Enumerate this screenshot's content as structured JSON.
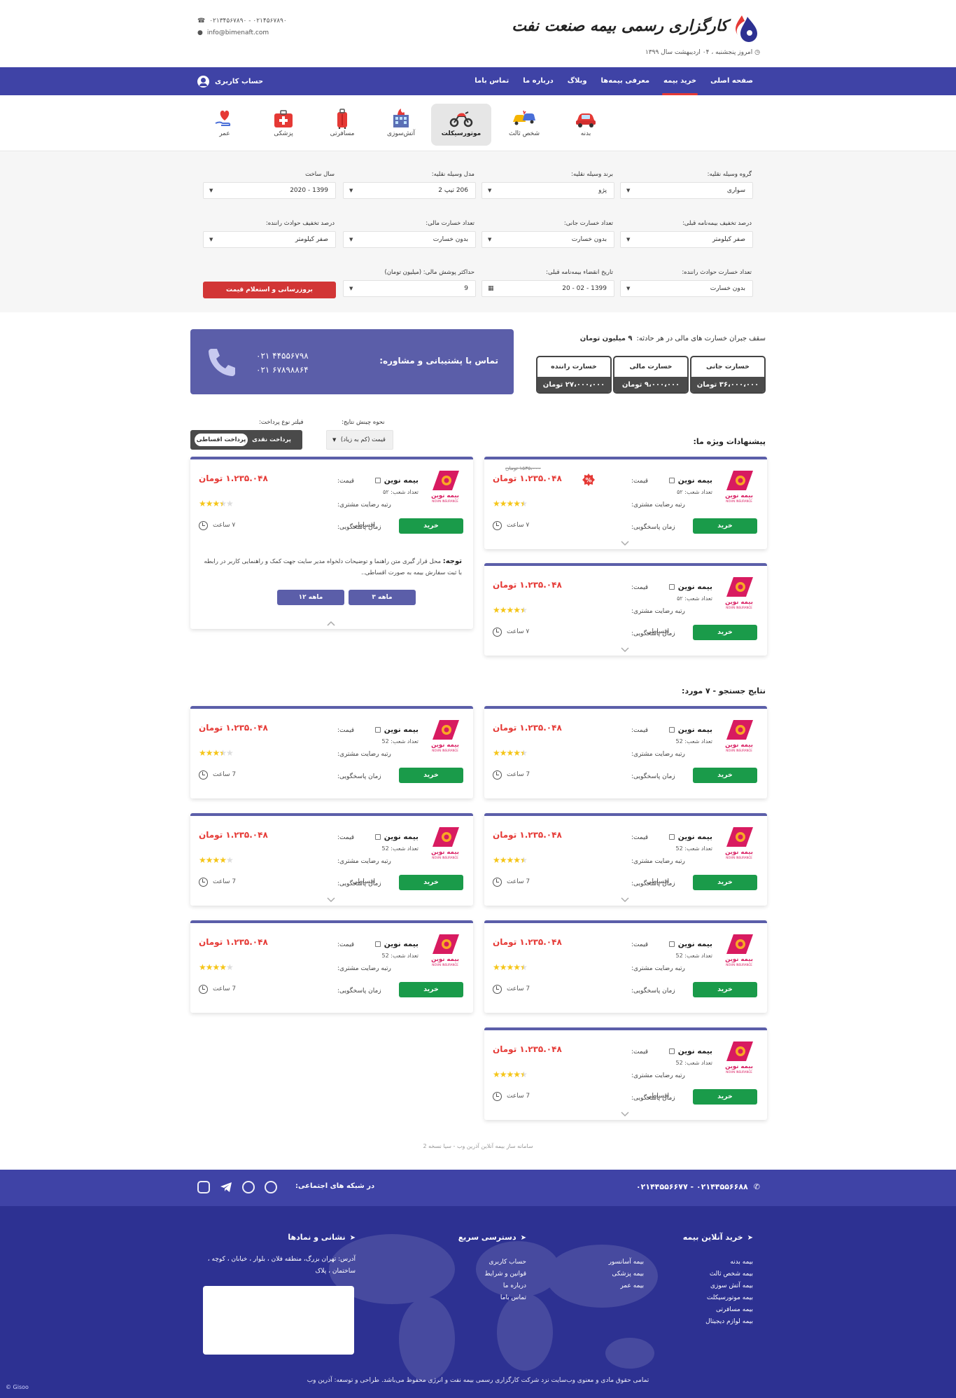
{
  "header": {
    "brand": "کارگزاری رسمی بیمه صنعت نفت",
    "date_text": "امروز پنجشنبه ، ۰۴ اردیبهشت سال ۱۳۹۹",
    "phone": "۰۲۱۳۴۵۶۷۸۹۰ - ۰۲۱۴۵۶۷۸۹۰",
    "email": "info@bimenaft.com"
  },
  "nav": {
    "items": [
      "صفحه اصلی",
      "خرید بیمه",
      "معرفی بیمه‌ها",
      "وبلاگ",
      "درباره ما",
      "تماس باما"
    ],
    "active_index": 1,
    "account_label": "حساب کاربری"
  },
  "categories": [
    {
      "label": "بدنه",
      "icon": "car-icon"
    },
    {
      "label": "شخص ثالث",
      "icon": "car-crash-icon"
    },
    {
      "label": "موتورسیکلت",
      "icon": "motorcycle-icon"
    },
    {
      "label": "آتش‌سوزی",
      "icon": "building-fire-icon"
    },
    {
      "label": "مسافرتی",
      "icon": "suitcase-icon"
    },
    {
      "label": "پزشکی",
      "icon": "medical-kit-icon"
    },
    {
      "label": "عمر",
      "icon": "heart-hand-icon"
    }
  ],
  "active_category": 2,
  "form": {
    "vehicle_group": {
      "label": "گروه وسیله نقلیه:",
      "value": "سواری"
    },
    "vehicle_brand": {
      "label": "برند وسیله نقلیه:",
      "value": "پژو"
    },
    "vehicle_model": {
      "label": "مدل وسیله نقلیه:",
      "value": "206 تیپ 2"
    },
    "build_year": {
      "label": "سال ساخت",
      "value": "1399 - 2020"
    },
    "prev_discount": {
      "label": "درصد تخفیف بیمه‌نامه قبلی:",
      "value": "صفر کیلومتر"
    },
    "life_damage": {
      "label": "تعداد خسارت جانی:",
      "value": "بدون خسارت"
    },
    "financial_damage": {
      "label": "تعداد خسارت مالی:",
      "value": "بدون خسارت"
    },
    "driver_discount": {
      "label": "درصد تخفیف حوادث راننده:",
      "value": "صفر کیلومتر"
    },
    "driver_damage": {
      "label": "تعداد خسارت حوادث راننده:",
      "value": "بدون خسارت"
    },
    "prev_expiry": {
      "label": "تاریخ انقضاء بیمه‌نامه قبلی:",
      "value": "1399 - 02 - 20"
    },
    "max_coverage": {
      "label": "حداکثر پوشش مالی: (میلیون تومان)",
      "value": "9"
    },
    "submit_label": "بروزرسانی و استعلام قیمت"
  },
  "coverage": {
    "title": "سقف جبران خسارت های مالی در هر حادثه:",
    "title_value": "۹ میلیون تومان",
    "items": [
      {
        "label": "خسارت جانی",
        "value": "۳۶،۰۰۰،۰۰۰ تومان"
      },
      {
        "label": "خسارت مالی",
        "value": "۹،۰۰۰،۰۰۰ تومان"
      },
      {
        "label": "خسارت راننده",
        "value": "۲۷،۰۰۰،۰۰۰ تومان"
      }
    ]
  },
  "support": {
    "title": "تماس با پشتیبانی و مشاوره:",
    "phone1": "۰۲۱ ۴۴۵۵۶۷۹۸",
    "phone2": "۰۲۱ ۶۷۸۹۸۸۶۴"
  },
  "results_controls": {
    "sort_label": "نحوه چینش نتایج:",
    "sort_value": "قیمت (کم به زیاد)",
    "filter_label": "فیلتر نوع پرداخت:",
    "pay_cash": "پرداخت نقدی",
    "pay_installment": "پرداخت اقساطی"
  },
  "special_title": "پیشنهادات ویژه ما:",
  "search_title": "نتایج جستجو - ۷ مورد:",
  "card_labels": {
    "price": "قیمت:",
    "rating": "رتبه رضایت مشتری:",
    "response": "زمان پاسخگویی:",
    "buy": "خرید",
    "installment": "اقساطی",
    "company": "بیمه نوین",
    "logo_fa": "بیمه نوین",
    "logo_en": "NOVIN INSURANCE"
  },
  "special_cards": [
    {
      "branches": "تعداد شعب: ۵۲",
      "price": "۱.۲۳۵.۰۴۸ تومان",
      "old_price": "۱۵۳۵،۰۰۰ تومان",
      "has_discount_badge": true,
      "rating": 4.5,
      "response": "۷ ساعت",
      "installment": false,
      "expandable": true
    },
    {
      "branches": "تعداد شعب: ۵۲",
      "price": "۱.۲۳۵.۰۴۸ تومان",
      "rating": 4.5,
      "response": "۷ ساعت",
      "installment": true,
      "expandable": true
    },
    {
      "branches": "تعداد شعب: ۵۲",
      "price": "۱.۲۳۵.۰۴۸ تومان",
      "rating": 3.5,
      "response": "۷ ساعت",
      "installment": true,
      "expanded": true
    }
  ],
  "expanded_note": {
    "title": "توجه:",
    "text": "محل قرار گیری متن راهنما و توضیحات دلخواه مدیر سایت جهت کمک و راهنمایی کاربر در رابطه با ثبت سفارش بیمه به صورت اقساطی..",
    "btn_3": "۳ ماهه",
    "btn_12": "۱۲ ماهه"
  },
  "search_cards": [
    {
      "branches": "تعداد شعب: 52",
      "price": "۱.۲۳۵.۰۴۸ تومان",
      "rating": 4.5,
      "response": "7 ساعت",
      "installment": false
    },
    {
      "branches": "تعداد شعب: 52",
      "price": "۱.۲۳۵.۰۴۸ تومان",
      "rating": 3.5,
      "response": "7 ساعت",
      "installment": false
    },
    {
      "branches": "تعداد شعب: 52",
      "price": "۱.۲۳۵.۰۴۸ تومان",
      "rating": 4.5,
      "response": "7 ساعت",
      "installment": true
    },
    {
      "branches": "تعداد شعب: 52",
      "price": "۱.۲۳۵.۰۴۸ تومان",
      "rating": 4,
      "response": "7 ساعت",
      "installment": true
    },
    {
      "branches": "تعداد شعب: 52",
      "price": "۱.۲۳۵.۰۴۸ تومان",
      "rating": 4.5,
      "response": "7 ساعت",
      "installment": false
    },
    {
      "branches": "تعداد شعب: 52",
      "price": "۱.۲۳۵.۰۴۸ تومان",
      "rating": 4,
      "response": "7 ساعت",
      "installment": false
    },
    {
      "branches": "تعداد شعب: 52",
      "price": "۱.۲۳۵.۰۴۸ تومان",
      "rating": 4.5,
      "response": "7 ساعت",
      "installment": true
    }
  ],
  "small_copyright": "سامانه ساز بیمه آنلاین آذرین وب - سیا نسخه 2",
  "footer": {
    "phones": "۰۲۱۴۴۵۵۶۶۸۸ - ۰۲۱۴۴۵۵۶۶۷۷",
    "social_title": "در شبکه های اجتماعی:",
    "col1_title": "خرید آنلاین بیمه",
    "col1_links": [
      "بیمه بدنه",
      "بیمه شخص ثالث",
      "بیمه آتش سوزی",
      "بیمه موتورسیکلت",
      "بیمه مسافرتی",
      "بیمه لوازم دیجیتال"
    ],
    "col1b_links": [
      "بیمه آسانسور",
      "بیمه پزشکی",
      "بیمه عمر"
    ],
    "col2_title": "دسترسی سریع",
    "col2_links": [
      "حساب کاربری",
      "قوانین و شرایط",
      "درباره ما",
      "تماس باما"
    ],
    "col3_title": "نشانی و نمادها",
    "address": "آدرس: تهران بزرگ، منطقه فلان ، بلوار ، خیابان ، کوچه ، ساختمان ، پلاک",
    "copyright": "تمامی حقوق مادی و معنوی وب‌سایت نزد شرکت کارگزاری رسمی بیمه نفت و انرژی محفوظ می‌باشد. طراحی و توسعه: آذرین وب",
    "credit": "© Gisoo"
  },
  "colors": {
    "primary": "#3f43a6",
    "card_accent": "#5b5ea9",
    "buy_green": "#1a9b4a",
    "price_red": "#e53935",
    "footer_dark": "#2d3192"
  }
}
